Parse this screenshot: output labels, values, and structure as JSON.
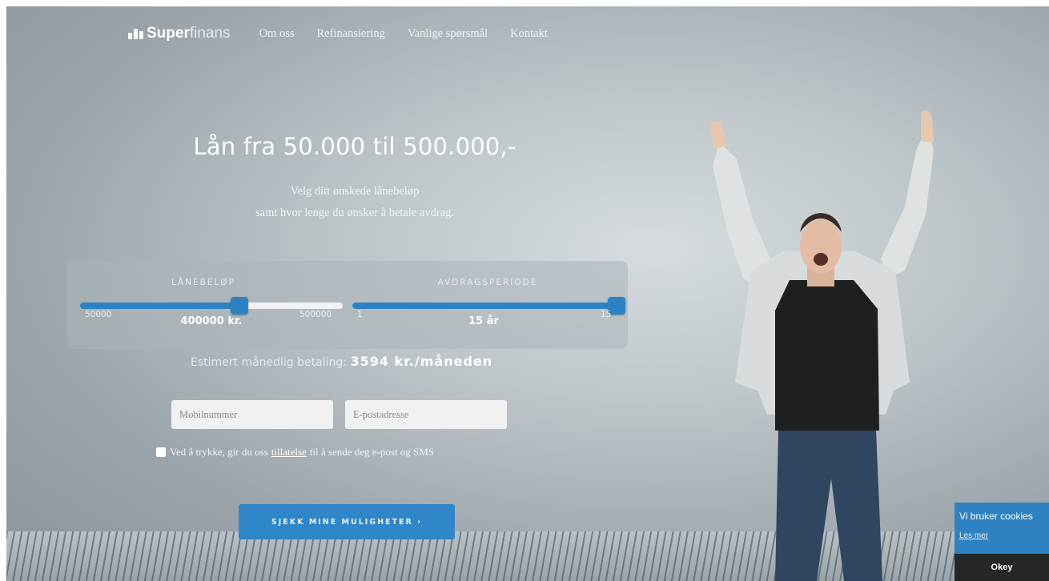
{
  "nav": {
    "logo_bold": "Super",
    "logo_light": "finans",
    "links": [
      "Om oss",
      "Refinansiering",
      "Vanlige spørsmål",
      "Kontakt"
    ]
  },
  "hero": {
    "headline": "Lån fra 50.000 til 500.000,-",
    "sub_line1": "Velg ditt ønskede lånebeløp",
    "sub_line2": "samt hvor lenge du ønsker å betale avdrag."
  },
  "sliders": {
    "amount": {
      "label": "LÅNEBELØP",
      "min": "50000",
      "max": "500000",
      "value_text": "400000 kr.",
      "value": 400000,
      "min_value": 50000,
      "max_value": 500000
    },
    "period": {
      "label": "AVDRAGSPERIODE",
      "min": "1",
      "max": "15",
      "value_text": "15 år",
      "value": 15,
      "min_value": 1,
      "max_value": 15
    }
  },
  "estimate": {
    "label": "Estimert månedlig betaling:",
    "value": "3594 kr./måneden"
  },
  "form": {
    "phone_placeholder": "Mobilnummer",
    "email_placeholder": "E-postadresse",
    "consent_before": "Ved å trykke, gir du oss",
    "consent_link": "tillatelse",
    "consent_after": "til å sende deg e-post og SMS",
    "cta_label": "SJEKK MINE MULIGHETER ›"
  },
  "cookie": {
    "text": "Vi bruker cookies",
    "link": "Les mer",
    "button": "Okey"
  },
  "colors": {
    "accent": "#2f82c2",
    "dark": "#23272a",
    "track_empty": "#f1f1f1"
  }
}
